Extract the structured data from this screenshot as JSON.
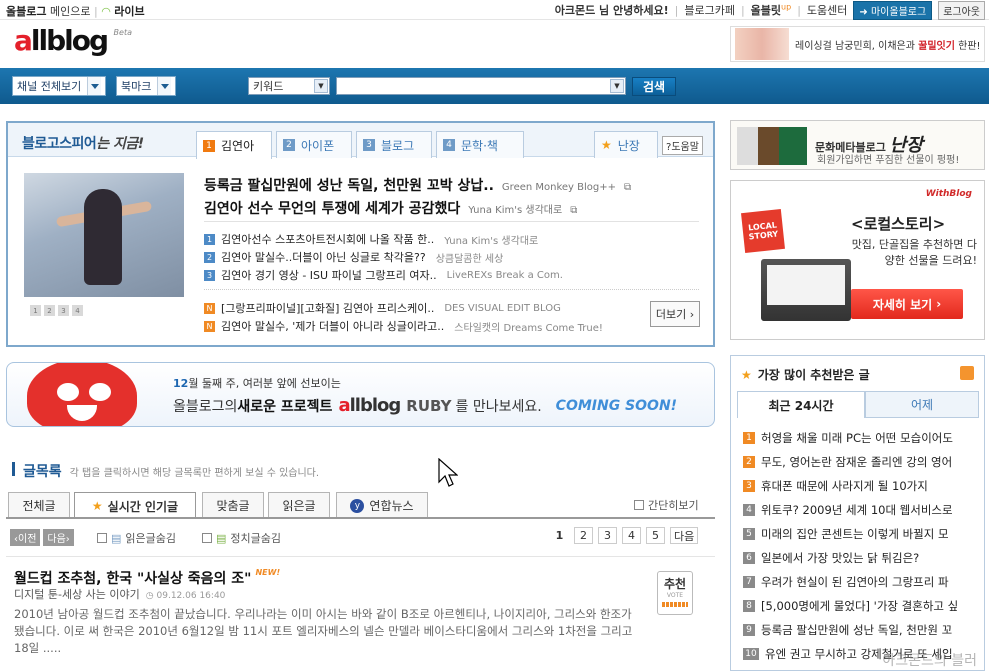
{
  "topbar": {
    "site": "올블로그",
    "main_link": "메인으로",
    "live": "라이브",
    "greeting": "아크몬드 님 안녕하세요!",
    "cafe": "블로그카페",
    "allblit": "올블릿",
    "allblit_sup": "up",
    "help": "도움센터",
    "my_blog": "마이올블로그",
    "logout": "로그아웃"
  },
  "header": {
    "logo_a": "a",
    "logo_rest": "llblog",
    "logo_beta": "Beta",
    "ad_text_prefix": "레이싱걸 남궁민희, 이채은과 ",
    "ad_text_highlight": "꿀밀잇기",
    "ad_text_suffix": " 한판!"
  },
  "navbar": {
    "channel_all": "채널 전체보기",
    "bookmark": "북마크",
    "keyword_select": "키워드",
    "search_value": "",
    "search_button": "검색"
  },
  "spire": {
    "title_a": "블로고스피어",
    "title_b": "는 지금!",
    "tabs": [
      {
        "num": "1",
        "label": "김연아"
      },
      {
        "num": "2",
        "label": "아이폰"
      },
      {
        "num": "3",
        "label": "블로그"
      },
      {
        "num": "4",
        "label": "문학·책"
      }
    ],
    "star_tab": "난장",
    "help": "도움말",
    "help_mark": "?",
    "dots": [
      "1",
      "2",
      "3",
      "4"
    ],
    "headlines": [
      {
        "title": "등록금 팔십만원에 성난 독일, 천만원 꼬박 상납..",
        "source": "Green Monkey Blog++"
      },
      {
        "title": "김연아 선수 무언의 투쟁에 세계가 공감했다",
        "source": "Yuna Kim's 생각대로"
      }
    ],
    "items": [
      {
        "badge": "1",
        "text": "김연아선수 스포츠아트전시회에 나올 작품 한..",
        "source": "Yuna Kim's 생각대로"
      },
      {
        "badge": "2",
        "text": "김연아 말실수..더블이 아닌 싱글로 착각을??",
        "source": "상큼달콤한 세상"
      },
      {
        "badge": "3",
        "text": "김연아 경기 영상 - ISU 파이널 그랑프리 여자..",
        "source": "LiveREXs Break a Com."
      }
    ],
    "news": [
      {
        "badge": "N",
        "text": "[그랑프리파이널][고화질] 김연아 프리스케이..",
        "source": "DES VISUAL EDIT BLOG"
      },
      {
        "badge": "N",
        "text": "김연아 말실수, '제가 더블이 아니라 싱글이라고..",
        "source": "스타일캣의 Dreams Come True!"
      }
    ],
    "more": "더보기 ›"
  },
  "ruby": {
    "line1_week": "12",
    "line1_rest": "월 둘째 주, 여러분 앞에 선보이는",
    "line2_a": "올블로그의 ",
    "line2_b": "새로운 프로젝트",
    "logo_a": "a",
    "logo_rest": "llblog",
    "ruby_word": "RUBY",
    "line2_c": "를 만나보세요.",
    "coming": "COMING SOON!"
  },
  "glist": {
    "title": "글목록",
    "desc": "각 탭을 클릭하시면 해당 글목록만 편하게 보실 수 있습니다.",
    "tabs": [
      "전체글",
      "실시간 인기글",
      "맞춤글",
      "읽은글",
      "연합뉴스"
    ],
    "simple_view": "간단히보기",
    "prev": "‹이전",
    "next": "다음›",
    "hide_read": "읽은글숨김",
    "hide_politics": "정치글숨김",
    "pages": [
      "1",
      "2",
      "3",
      "4",
      "5"
    ],
    "next_page": "다음"
  },
  "article": {
    "title": "월드컵 조추첨, 한국 \"사실상 죽음의 조\"",
    "new_badge": "NEW!",
    "meta": "디지털 툰-세상 사는 이야기",
    "time": "09.12.06 16:40",
    "body": "2010년 남아공 월드컵 조추첨이 끝났습니다. 우리나라는 이미 아시는 바와 같이 B조로 아르헨티나, 나이지리아, 그리스와 한조가 됐습니다. 이로 써 한국은 2010년 6월12일 밤 11시 포트 엘리자베스의 넬슨 만델라 베이스타디움에서 그리스와 1차전을 그리고 18일 .....",
    "vote_label": "추천",
    "vote_sub": "VOTE"
  },
  "right": {
    "ad1_a": "문화메타블로그 ",
    "ad1_big": "난장",
    "ad1_sub": "회원가입하면 푸짐한 선물이 펑펑!",
    "ad2_with": "WithBlog",
    "ad2_badge": "LOCAL STORY",
    "ad2_h1": "<로컬스토리>",
    "ad2_h2": "맛집, 단골집을 추천하면 다양한 선물을 드려요!",
    "ad2_cta": "자세히 보기",
    "rec_title": "가장 많이 추천받은 글",
    "rec_tabs": [
      "최근 24시간",
      "어제"
    ],
    "rec_items": [
      {
        "n": "1",
        "text": "허영을 채울 미래 PC는 어떤 모습이어도"
      },
      {
        "n": "2",
        "text": "무도, 영어논란 잠재운 졸리엔 강의 영어"
      },
      {
        "n": "3",
        "text": "휴대폰 때문에 사라지게 될 10가지"
      },
      {
        "n": "4",
        "text": "위토쿠? 2009년 세계 10대 웹서비스로 "
      },
      {
        "n": "5",
        "text": "미래의 집안 콘센트는 이렇게 바뀔지 모"
      },
      {
        "n": "6",
        "text": "일본에서 가장 맛있는 닭 튀김은?"
      },
      {
        "n": "7",
        "text": "우려가 현실이 된 김연아의 그랑프리 파"
      },
      {
        "n": "8",
        "text": "[5,000명에게 물었다] '가장 결혼하고 싶"
      },
      {
        "n": "9",
        "text": "등록금 팔십만원에 성난 독일, 천만원 꼬"
      },
      {
        "n": "10",
        "text": "유엔 권고 무시하고 강제철거로 또 세입"
      }
    ],
    "watermark": "아크몬드의 블러"
  },
  "colors": {
    "accent": "#1d76b0",
    "orange": "#f08a24",
    "red": "#e4202b"
  }
}
